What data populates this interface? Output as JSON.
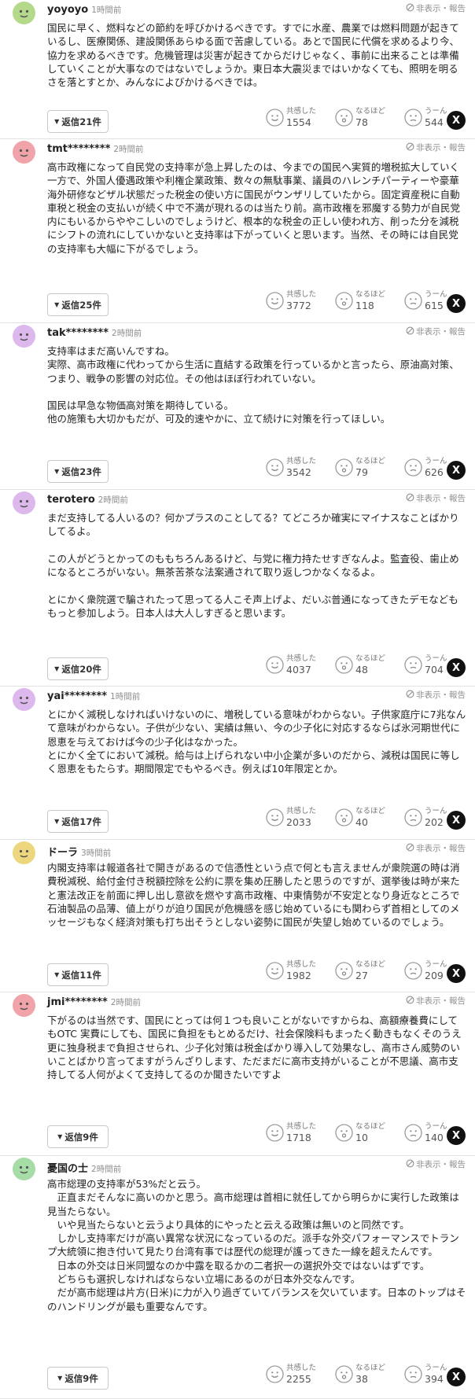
{
  "labels": {
    "hide_report": "非表示・報告",
    "react_empathy": "共感した",
    "react_indeed": "なるほど",
    "react_hmm": "うーん",
    "x_share": "X"
  },
  "colors": {
    "accent_dark": "#111111",
    "divider": "#e2e2e2"
  },
  "comments": [
    {
      "user": "yoyoyo",
      "time": "1時間前",
      "avatar_color": "#b5d98a",
      "body": "国民に早く、燃料などの節約を呼びかけるべきです。すでに水産、農業では燃料問題が起きているし、医療関係、建設関係あらゆる面で苦慮している。あとで国民に代償を求めるより今、協力を求めるべきです。危機管理は災害が起きてからだけじゃなく、事前に出来ることは準備していくことが大事なのではないでしょうか。東日本大震災まではいかなくても、照明を明るさを落とすとか、みんなによびかけるべきでは。",
      "reply_label": "返信21件",
      "empathy": "1554",
      "indeed": "78",
      "hmm": "544"
    },
    {
      "user": "tmt********",
      "time": "2時間前",
      "avatar_color": "#f0a3a8",
      "body": "高市政権になって自民党の支持率が急上昇したのは、今までの国民へ実質的増税拡大していく一方で、外国人優遇政策や利権企業政策、数々の無駄事業、議員のハレンチパーティーや豪華海外研修などザル状態だった税金の使い方に国民がウンザリしていたから。固定資産税に自動車税と税金の支払いが続く中で不満が現れるのは当たり前。高市政権を邪魔する勢力が自民党内にもいるからややこしいのでしょうけど、根本的な税金の正しい使われ方、削った分を減税にシフトの流れにしていかないと支持率は下がっていくと思います。当然、その時には自民党の支持率も大幅に下がるでしょう。",
      "reply_label": "返信25件",
      "empathy": "3772",
      "indeed": "118",
      "hmm": "615"
    },
    {
      "user": "tak********",
      "time": "2時間前",
      "avatar_color": "#ddb8ec",
      "body": "支持率はまだ高いんですね。\n実際、高市政権に代わってから生活に直結する政策を行っているかと言ったら、原油高対策、つまり、戦争の影響の対応位。その他はほぼ行われていない。\n\n国民は早急な物価高対策を期待している。\n他の施策も大切かもだが、可及的速やかに、立て続けに対策を行ってほしい。",
      "reply_label": "返信23件",
      "empathy": "3542",
      "indeed": "79",
      "hmm": "626"
    },
    {
      "user": "terotero",
      "time": "2時間前",
      "avatar_color": "#ddb8ec",
      "body": "まだ支持してる人いるの？何かプラスのことしてる？てどころか確実にマイナスなことばかりしてるよ。\n\nこの人がどうとかってのももちろんあるけど、与党に権力持たせすぎなんよ。監査役、歯止めになるところがいない。無茶苦茶な法案通されて取り返しつかなくなるよ。\n\nとにかく衆院選で騙されたって思ってる人こそ声上げよ、だいぶ普通になってきたデモなどももっと参加しよう。日本人は大人しすぎると思います。",
      "reply_label": "返信20件",
      "empathy": "4037",
      "indeed": "48",
      "hmm": "704"
    },
    {
      "user": "yai********",
      "time": "1時間前",
      "avatar_color": "#ddb8ec",
      "body": "とにかく減税しなければいけないのに、増税している意味がわからない。子供家庭庁に7兆なんて意味がわからない。子供が少ない、実績は無い、今の少子化に対応するならば氷河期世代に恩恵を与えておけば今の少子化はなかった。\nとにかく全てにおいて減税。給与は上げられない中小企業が多いのだから、減税は国民に等しく恩恵をもたらす。期間限定でもやるべき。例えば10年限定とか。",
      "reply_label": "返信17件",
      "empathy": "2033",
      "indeed": "40",
      "hmm": "202"
    },
    {
      "user": "ドーラ",
      "time": "3時間前",
      "avatar_color": "#ecd77e",
      "body": "内閣支持率は報道各社で開きがあるので信憑性という点で何とも言えませんが衆院選の時は消費税減税、給付金付き税額控除を公約に票を集め圧勝したと思うのですが、選挙後は時が来たと憲法改正を前面に押し出し意欲を燃やす高市政権、中東情勢が不安定となり身近なところで石油製品の品薄、値上がりが迫り国民が危機感を感じ始めているにも関わらず首相としてのメッセージもなく経済対策も打ち出そうとしない姿勢に国民が失望し始めているのでしょう。",
      "reply_label": "返信11件",
      "empathy": "1982",
      "indeed": "27",
      "hmm": "209"
    },
    {
      "user": "jmi********",
      "time": "2時間前",
      "avatar_color": "#f0a3a8",
      "body": "下がるのは当然です、国民にとっては何１つも良いことがないですからね、高額療養費にしてもOTC 実費にしても、国民に負担をもとめるだけ、社会保険料もまったく動きもなくそのうえ更に独身税まで負担させられ、少子化対策は税金ばかり導入して効果なし、高市さん威勢のいいことばかり言ってますがうんざりします、ただまだに高市支持がいることが不思議、高市支持してる人何がよくて支持してるのか聞きたいですよ",
      "reply_label": "返信9件",
      "empathy": "1718",
      "indeed": "10",
      "hmm": "140"
    },
    {
      "user": "憂国の士",
      "time": "2時間前",
      "avatar_color": "#a6dca6",
      "body": "高市総理の支持率が53%だと云う。\n　正直まだそんなに高いのかと思う。高市総理は首相に就任してから明らかに実行した政策は見当たらない。\n　いや見当たらないと云うより具体的にやったと云える政策は無いのと同然です。\n　しかし支持率だけが高い異常な状況になっているのだ。派手な外交パフォーマンスでトランプ大統領に抱き付いて見たり台湾有事では歴代の総理が護ってきた一線を超えたんです。\n　日本の外交は日米同盟なのか中露を取るかの二者択一の選択外交ではないはずです。\n　どちらも選択しなければならない立場にあるのが日本外交なんです。\n　だが高市総理は片方(日米)に力が入り過ぎていてバランスを欠いています。日本のトップはそのハンドリングが最も重要なんです。",
      "reply_label": "返信9件",
      "empathy": "2255",
      "indeed": "38",
      "hmm": "394"
    }
  ]
}
